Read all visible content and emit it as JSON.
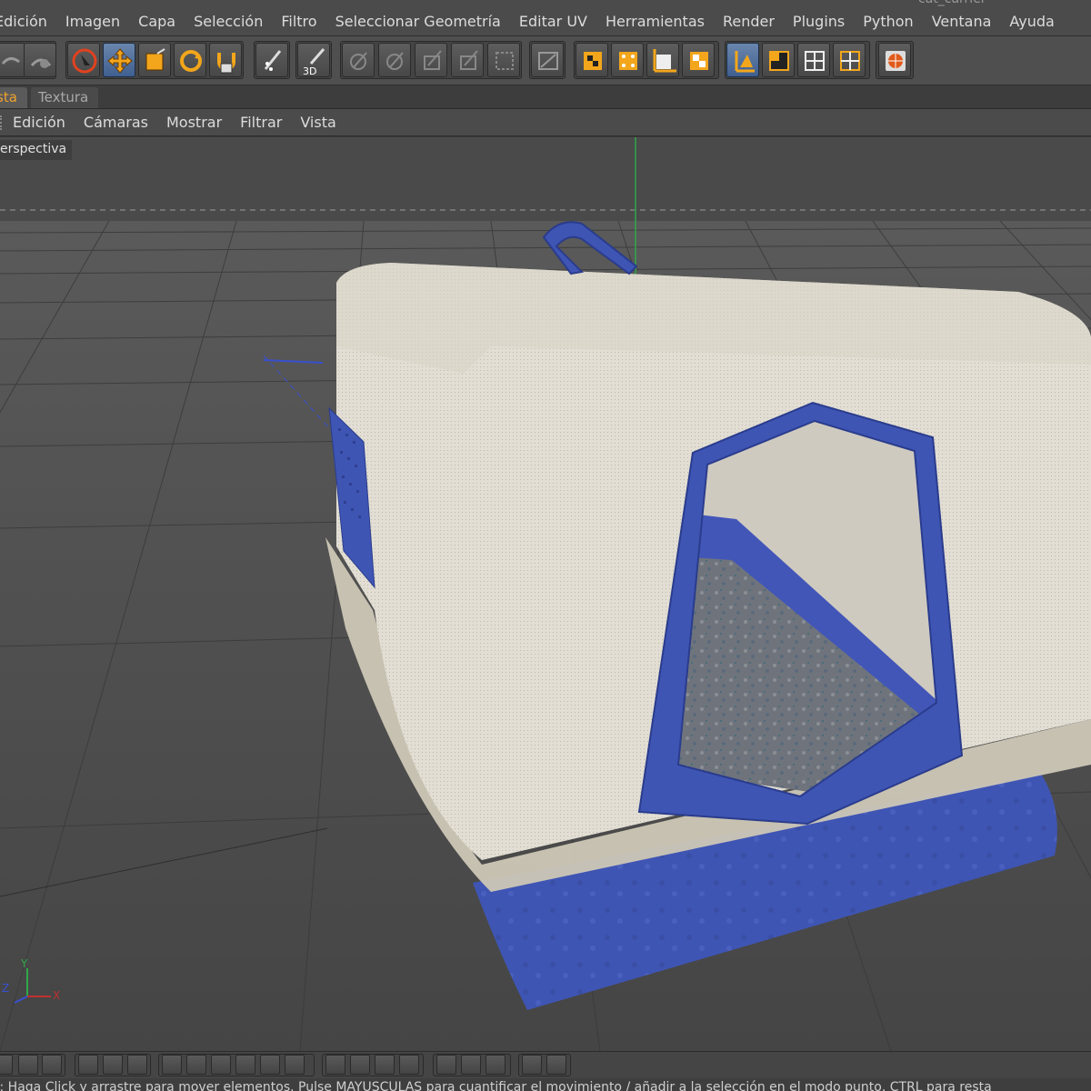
{
  "window": {
    "title_fragment": "cat_carrier"
  },
  "menubar": {
    "items": [
      {
        "label": "Edición"
      },
      {
        "label": "Imagen"
      },
      {
        "label": "Capa"
      },
      {
        "label": "Selección"
      },
      {
        "label": "Filtro"
      },
      {
        "label": "Seleccionar Geometría"
      },
      {
        "label": "Editar UV"
      },
      {
        "label": "Herramientas"
      },
      {
        "label": "Render"
      },
      {
        "label": "Plugins"
      },
      {
        "label": "Python"
      },
      {
        "label": "Ventana"
      },
      {
        "label": "Ayuda"
      }
    ]
  },
  "toolbar": {
    "tools": [
      {
        "icon": "undo-icon"
      },
      {
        "icon": "redo-icon"
      },
      {
        "icon": "live-selection-icon"
      },
      {
        "icon": "move-icon",
        "active": true
      },
      {
        "icon": "scale-icon"
      },
      {
        "icon": "rotate-icon"
      },
      {
        "icon": "texture-axis-icon"
      },
      {
        "icon": "brush-icon"
      },
      {
        "icon": "paint-3d-icon",
        "text": "3D"
      },
      {
        "icon": "brush-preset-1-icon"
      },
      {
        "icon": "brush-preset-2-icon"
      },
      {
        "icon": "brush-preset-3-icon"
      },
      {
        "icon": "brush-preset-4-icon"
      },
      {
        "icon": "brush-preset-5-icon"
      },
      {
        "icon": "layer-mask-icon"
      },
      {
        "icon": "texture-mode-icon"
      },
      {
        "icon": "uv-checker-icon"
      },
      {
        "icon": "uv-points-icon"
      },
      {
        "icon": "checkerboard-icon"
      },
      {
        "icon": "object-axis-icon",
        "active": true
      },
      {
        "icon": "viewport-layout-1-icon"
      },
      {
        "icon": "viewport-layout-2-icon"
      },
      {
        "icon": "viewport-layout-3-icon"
      },
      {
        "icon": "render-view-icon"
      }
    ]
  },
  "tabs": [
    {
      "label": "sta",
      "active": true
    },
    {
      "label": "Textura",
      "active": false
    }
  ],
  "viewport_menu": {
    "items": [
      {
        "label": "Edición"
      },
      {
        "label": "Cámaras"
      },
      {
        "label": "Mostrar"
      },
      {
        "label": "Filtrar"
      },
      {
        "label": "Vista"
      }
    ]
  },
  "viewport": {
    "label": "erspectiva",
    "axis": {
      "y": "Y",
      "z": "Z",
      "x": "X"
    }
  },
  "colors": {
    "accent_orange": "#f0a030",
    "active_blue": "#5577a6",
    "carrier_blue": "#3f55b4",
    "carrier_white": "#e4e0d6"
  },
  "statusbar": {
    "text": "r: Haga Click y arrastre para mover elementos. Pulse MAYUSCULAS para cuantificar el movimiento / añadir a la selección en el modo punto, CTRL para resta"
  }
}
